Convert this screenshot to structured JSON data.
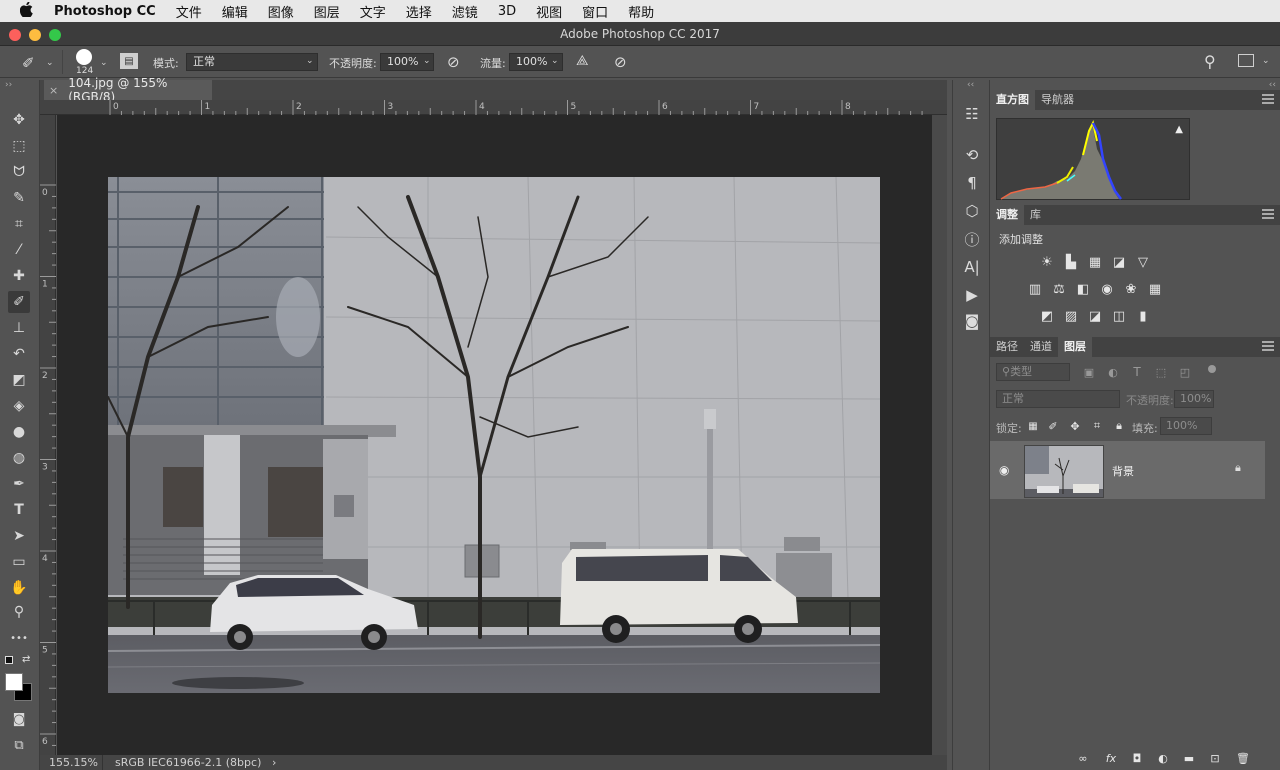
{
  "menubar": {
    "apple": "",
    "app_name": "Photoshop CC",
    "items": [
      "文件",
      "编辑",
      "图像",
      "图层",
      "文字",
      "选择",
      "滤镜",
      "3D",
      "视图",
      "窗口",
      "帮助"
    ]
  },
  "window": {
    "title": "Adobe Photoshop CC 2017",
    "traffic_colors": [
      "#fc605c",
      "#fdbc40",
      "#34c84a"
    ]
  },
  "options": {
    "brush_size": "124",
    "mode_label": "模式:",
    "mode_value": "正常",
    "opacity_label": "不透明度:",
    "opacity_value": "100%",
    "flow_label": "流量:",
    "flow_value": "100%"
  },
  "document": {
    "tab_close": "×",
    "tab_title": "104.jpg @ 155%(RGB/8)",
    "zoom": "155.15%",
    "profile": "sRGB IEC61966-2.1 (8bpc)",
    "status_arrow": "›"
  },
  "ruler": {
    "h_labels": [
      "0",
      "1",
      "2",
      "3",
      "4",
      "5",
      "6",
      "7",
      "8"
    ],
    "v_labels": [
      "0",
      "1",
      "2",
      "3",
      "4",
      "5",
      "6"
    ]
  },
  "tools": [
    {
      "name": "move-tool",
      "glyph": "✥"
    },
    {
      "name": "marquee-tool",
      "glyph": "⬚"
    },
    {
      "name": "lasso-tool",
      "glyph": "ᗢ"
    },
    {
      "name": "quick-select-tool",
      "glyph": "✎"
    },
    {
      "name": "crop-tool",
      "glyph": "⌗"
    },
    {
      "name": "eyedropper-tool",
      "glyph": "⁄"
    },
    {
      "name": "healing-brush-tool",
      "glyph": "✚"
    },
    {
      "name": "brush-tool",
      "glyph": "✐"
    },
    {
      "name": "clone-stamp-tool",
      "glyph": "⊥"
    },
    {
      "name": "history-brush-tool",
      "glyph": "↶"
    },
    {
      "name": "eraser-tool",
      "glyph": "◩"
    },
    {
      "name": "paint-bucket-tool",
      "glyph": "◈"
    },
    {
      "name": "blur-tool",
      "glyph": "●"
    },
    {
      "name": "dodge-tool",
      "glyph": "◍"
    },
    {
      "name": "pen-tool",
      "glyph": "✒"
    },
    {
      "name": "type-tool",
      "glyph": "T"
    },
    {
      "name": "path-select-tool",
      "glyph": "➤"
    },
    {
      "name": "rectangle-tool",
      "glyph": "▭"
    },
    {
      "name": "hand-tool",
      "glyph": "✋"
    },
    {
      "name": "zoom-tool",
      "glyph": "⚲"
    },
    {
      "name": "more-tools",
      "glyph": "•••"
    }
  ],
  "panels": {
    "histogram_tab": "直方图",
    "navigator_tab": "导航器",
    "warning": "▲",
    "adjust_tab": "调整",
    "library_tab": "库",
    "add_adjustment": "添加调整",
    "adj_row1": [
      "☀",
      "▙",
      "▦",
      "◪",
      "▽"
    ],
    "adj_row2": [
      "▥",
      "⚖",
      "◧",
      "◉",
      "❀",
      "▦"
    ],
    "adj_row3": [
      "◩",
      "▨",
      "◪",
      "◫",
      "▮"
    ],
    "paths_tab": "路径",
    "channels_tab": "通道",
    "layers_tab": "图层",
    "filter_kind": "类型",
    "blend_mode": "正常",
    "opacity_label": "不透明度:",
    "opacity_value": "100%",
    "lock_label": "锁定:",
    "fill_label": "填充:",
    "fill_value": "100%",
    "layer_name": "背景"
  }
}
